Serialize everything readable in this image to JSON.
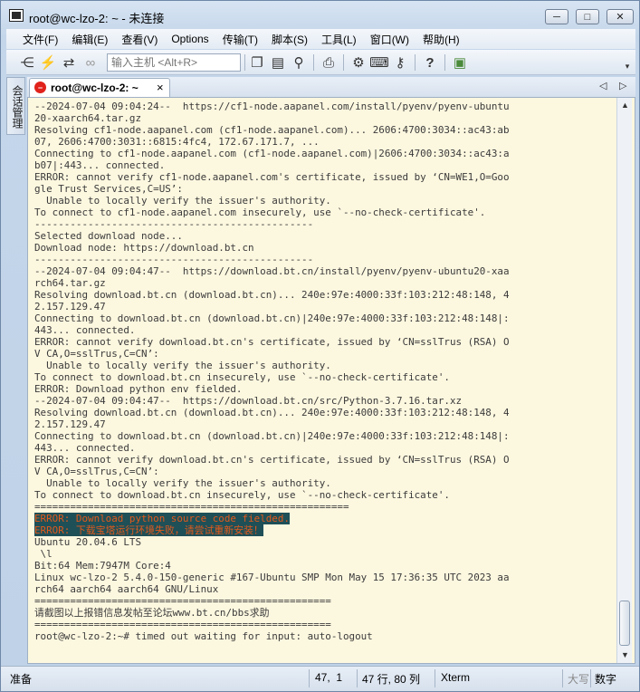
{
  "window": {
    "title": "root@wc-lzo-2: ~ - 未连接",
    "min_label": "─",
    "max_label": "□",
    "close_label": "✕"
  },
  "menu": [
    "文件(F)",
    "编辑(E)",
    "查看(V)",
    "Options",
    "传输(T)",
    "脚本(S)",
    "工具(L)",
    "窗口(W)",
    "帮助(H)"
  ],
  "toolbar": {
    "host_placeholder": "输入主机 <Alt+R>",
    "icons": [
      "connect-tree-icon",
      "lightning-icon",
      "reconnect-icon",
      "link-icon",
      "copy-icon",
      "paste-icon",
      "find-icon",
      "print-icon",
      "settings-gear-icon",
      "keyboard-icon",
      "key-icon",
      "help-icon",
      "sftp-icon"
    ]
  },
  "side_panel": {
    "label": "会话管理"
  },
  "tab": {
    "label": "root@wc-lzo-2: ~",
    "close": "×",
    "status_color": "#e0221b"
  },
  "terminal": {
    "lines": [
      "--2024-07-04 09:04:24--  https://cf1-node.aapanel.com/install/pyenv/pyenv-ubuntu",
      "20-xaarch64.tar.gz",
      "Resolving cf1-node.aapanel.com (cf1-node.aapanel.com)... 2606:4700:3034::ac43:ab",
      "07, 2606:4700:3031::6815:4fc4, 172.67.171.7, ...",
      "Connecting to cf1-node.aapanel.com (cf1-node.aapanel.com)|2606:4700:3034::ac43:a",
      "b07|:443... connected.",
      "ERROR: cannot verify cf1-node.aapanel.com's certificate, issued by ‘CN=WE1,O=Goo",
      "gle Trust Services,C=US’:",
      "  Unable to locally verify the issuer's authority.",
      "To connect to cf1-node.aapanel.com insecurely, use `--no-check-certificate'.",
      "-----------------------------------------------",
      "Selected download node...",
      "Download node: https://download.bt.cn",
      "-----------------------------------------------",
      "--2024-07-04 09:04:47--  https://download.bt.cn/install/pyenv/pyenv-ubuntu20-xaa",
      "rch64.tar.gz",
      "Resolving download.bt.cn (download.bt.cn)... 240e:97e:4000:33f:103:212:48:148, 4",
      "2.157.129.47",
      "Connecting to download.bt.cn (download.bt.cn)|240e:97e:4000:33f:103:212:48:148|:",
      "443... connected.",
      "ERROR: cannot verify download.bt.cn's certificate, issued by ‘CN=sslTrus (RSA) O",
      "V CA,O=sslTrus,C=CN’:",
      "  Unable to locally verify the issuer's authority.",
      "To connect to download.bt.cn insecurely, use `--no-check-certificate'.",
      "ERROR: Download python env fielded.",
      "--2024-07-04 09:04:47--  https://download.bt.cn/src/Python-3.7.16.tar.xz",
      "Resolving download.bt.cn (download.bt.cn)... 240e:97e:4000:33f:103:212:48:148, 4",
      "2.157.129.47",
      "Connecting to download.bt.cn (download.bt.cn)|240e:97e:4000:33f:103:212:48:148|:",
      "443... connected.",
      "ERROR: cannot verify download.bt.cn's certificate, issued by ‘CN=sslTrus (RSA) O",
      "V CA,O=sslTrus,C=CN’:",
      "  Unable to locally verify the issuer's authority.",
      "To connect to download.bt.cn insecurely, use `--no-check-certificate'.",
      "=====================================================",
      "ERROR: Download python source code fielded.",
      "ERROR: 下载宝塔运行环境失败，请尝试重新安装！",
      "Ubuntu 20.04.6 LTS",
      " \\l",
      "Bit:64 Mem:7947M Core:4",
      "Linux wc-lzo-2 5.4.0-150-generic #167-Ubuntu SMP Mon May 15 17:36:35 UTC 2023 aa",
      "rch64 aarch64 aarch64 GNU/Linux",
      "==================================================",
      "请截图以上报错信息发帖至论坛www.bt.cn/bbs求助",
      "==================================================",
      "root@wc-lzo-2:~# timed out waiting for input: auto-logout"
    ],
    "highlight_lines": [
      35,
      36
    ],
    "text_color": "#3b3b3b",
    "background": "#fcf7df",
    "highlight_bg": "#1f4f57",
    "highlight_fg": "#e05a1c"
  },
  "statusbar": {
    "ready": "准备",
    "cursor": "47,  1",
    "size": "47 行, 80 列",
    "terminal_type": "Xterm",
    "caps": "大写",
    "num": "数字"
  }
}
